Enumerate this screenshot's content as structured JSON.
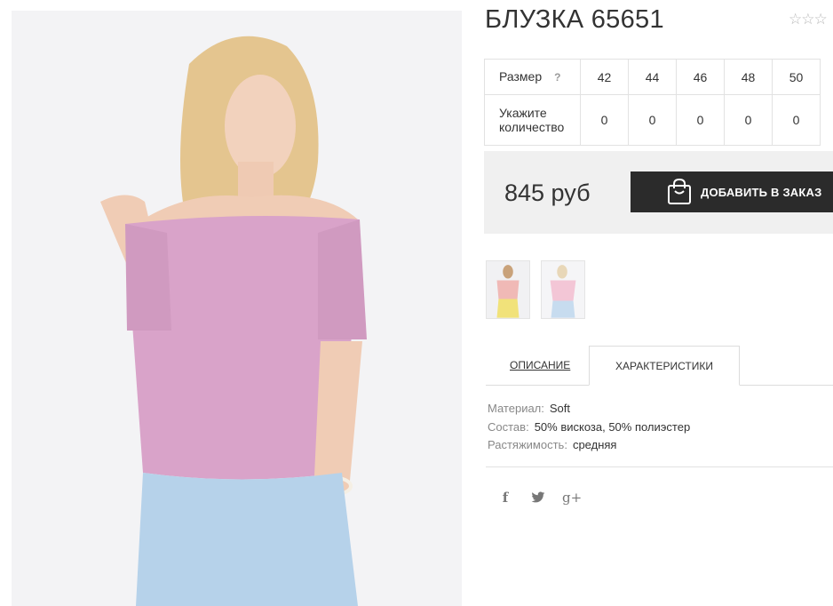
{
  "product": {
    "title": "БЛУЗКА 65651",
    "rating_stars": "☆☆☆"
  },
  "size_table": {
    "size_label": "Размер",
    "help_label": "?",
    "sizes": [
      "42",
      "44",
      "46",
      "48",
      "50"
    ],
    "quantity_label": "Укажите количество",
    "quantities": [
      "0",
      "0",
      "0",
      "0",
      "0"
    ]
  },
  "purchase": {
    "price": "845 руб",
    "order_button": "ДОБАВИТЬ В ЗАКАЗ"
  },
  "tabs": {
    "description": "ОПИСАНИЕ",
    "characteristics": "ХАРАКТЕРИСТИКИ"
  },
  "characteristics": [
    {
      "key": "Материал:",
      "value": "Soft"
    },
    {
      "key": "Состав:",
      "value": "50% вискоза, 50% полиэстер"
    },
    {
      "key": "Растяжимость:",
      "value": "средняя"
    }
  ],
  "social": {
    "facebook": "f",
    "twitter": "🐦",
    "googleplus": "g+"
  },
  "colors": {
    "blouse": "#d9a3c9",
    "trousers": "#b6d2ea",
    "button_bg": "#2b2b2b",
    "price_bg": "#f0f0f0"
  }
}
